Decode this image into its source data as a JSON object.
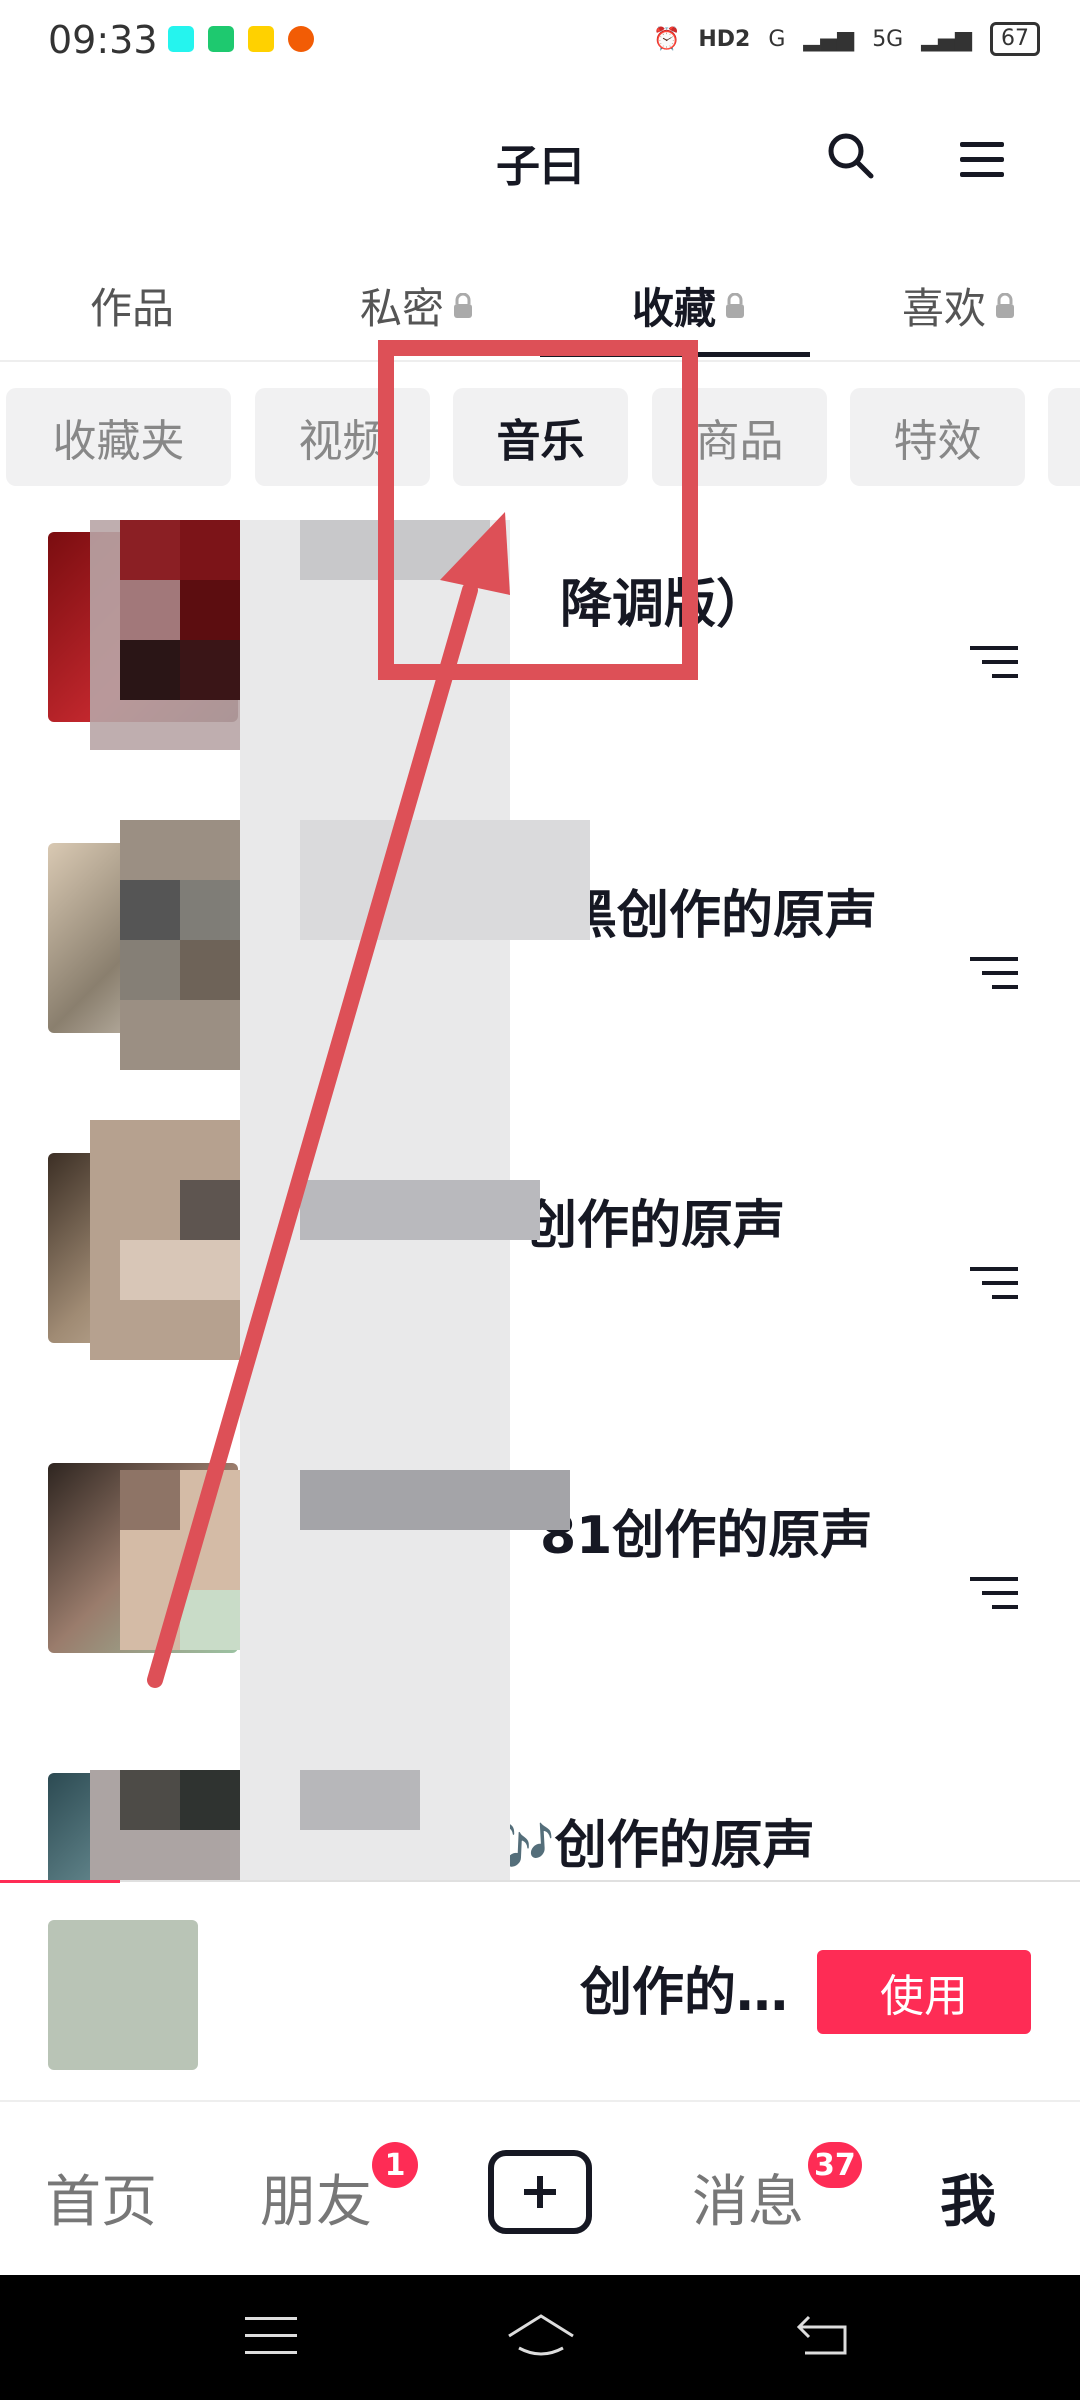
{
  "status_bar": {
    "time": "09:33",
    "hd": "HD2",
    "net1": "G",
    "net2": "5G",
    "battery": "67"
  },
  "header": {
    "title": "子曰"
  },
  "tabs": [
    {
      "label": "作品",
      "locked": false
    },
    {
      "label": "私密",
      "locked": true
    },
    {
      "label": "收藏",
      "locked": true,
      "active": true
    },
    {
      "label": "喜欢",
      "locked": true
    }
  ],
  "chips": [
    {
      "label": "收藏夹"
    },
    {
      "label": "视频"
    },
    {
      "label": "音乐",
      "active": true
    },
    {
      "label": "商品"
    },
    {
      "label": "特效"
    }
  ],
  "music_list": [
    {
      "title": "降调版）"
    },
    {
      "title": "黑创作的原声"
    },
    {
      "title": "创作的原声"
    },
    {
      "title": "81创作的原声"
    },
    {
      "title": "🎶创作的原声"
    }
  ],
  "now_playing": {
    "title": "创作的…",
    "use_label": "使用"
  },
  "bottom_nav": {
    "home": "首页",
    "friends": "朋友",
    "friends_badge": "1",
    "messages": "消息",
    "messages_badge": "37",
    "me": "我"
  },
  "colors": {
    "accent": "#fe2c55",
    "annotation": "#dd5057",
    "chip_bg": "#f1f1f2"
  }
}
